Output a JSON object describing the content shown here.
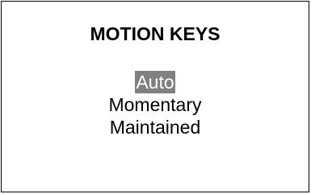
{
  "screen": {
    "title": "MOTION KEYS",
    "options": [
      {
        "label": "Auto",
        "selected": true
      },
      {
        "label": "Momentary",
        "selected": false
      },
      {
        "label": "Maintained",
        "selected": false
      }
    ]
  },
  "colors": {
    "background": "#ffffff",
    "text": "#000000",
    "border": "#000000",
    "selection_background": "#808080",
    "selection_text": "#ffffff"
  }
}
